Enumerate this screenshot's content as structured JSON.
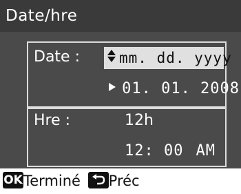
{
  "title": "Date/hre",
  "date": {
    "label": "Date :",
    "format_value": "mm. dd. yyyy",
    "value": "01. 01. 2008"
  },
  "time": {
    "label": "Hre :",
    "format_value": "12h",
    "value": "12: 00",
    "ampm": "AM"
  },
  "footer": {
    "ok_key": "OK",
    "ok_label": "Terminé",
    "back_label": "Préc"
  },
  "colors": {
    "title_bg": "#3a3a3a",
    "panel_bg": "#4a4a4a",
    "selected_bg": "#e0e0e0"
  }
}
